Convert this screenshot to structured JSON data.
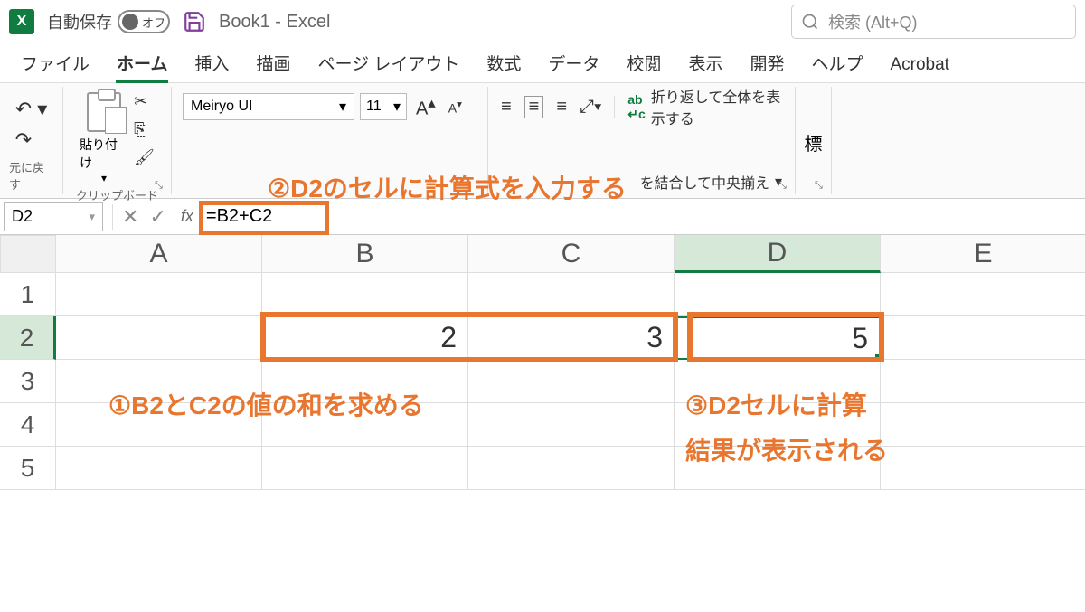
{
  "titleBar": {
    "excelLetter": "X",
    "autosave": "自動保存",
    "autosaveOff": "オフ",
    "docTitle": "Book1  -  Excel",
    "searchPlaceholder": "検索 (Alt+Q)"
  },
  "tabs": [
    "ファイル",
    "ホーム",
    "挿入",
    "描画",
    "ページ レイアウト",
    "数式",
    "データ",
    "校閲",
    "表示",
    "開発",
    "ヘルプ",
    "Acrobat"
  ],
  "activeTab": 1,
  "ribbon": {
    "undoLabel": "元に戻す",
    "clipboardLabel": "クリップボード",
    "pasteLabel": "貼り付け",
    "fontName": "Meiryo UI",
    "fontSize": "11",
    "wrapText": "折り返して全体を表示する",
    "mergeText": "を結合して中央揃え",
    "styleText": "標"
  },
  "formulaBar": {
    "nameBox": "D2",
    "formula": "=B2+C2"
  },
  "grid": {
    "cols": [
      "A",
      "B",
      "C",
      "D",
      "E"
    ],
    "rows": [
      "1",
      "2",
      "3",
      "4",
      "5"
    ],
    "b2": "2",
    "c2": "3",
    "d2": "5"
  },
  "annotations": {
    "a1": "①B2とC2の値の和を求める",
    "a2": "②D2のセルに計算式を入力する",
    "a3a": "③D2セルに計算",
    "a3b": "結果が表示される"
  }
}
